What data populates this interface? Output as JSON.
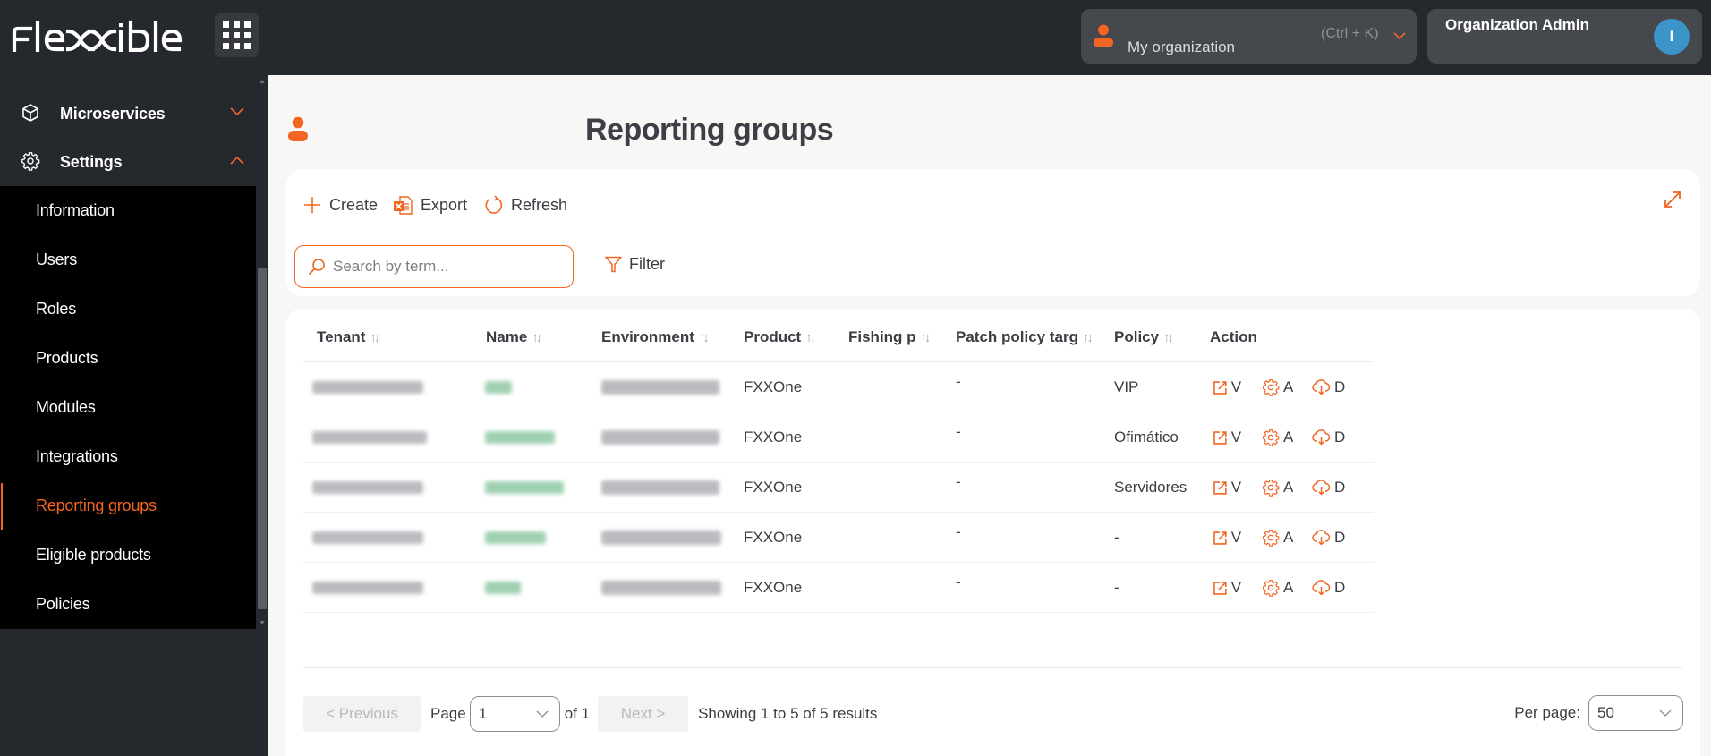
{
  "app": {
    "brand": "Flexxible"
  },
  "topbar": {
    "org_selector": {
      "label": "My organization",
      "shortcut": "(Ctrl + K)"
    },
    "user": {
      "role": "Organization Admin",
      "avatar_initial": "I"
    }
  },
  "sidebar": {
    "groups": [
      {
        "label": "Microservices",
        "icon": "cube-icon",
        "expanded": false
      },
      {
        "label": "Settings",
        "icon": "gear-icon",
        "expanded": true
      }
    ],
    "settings_items": [
      {
        "label": "Information",
        "active": false
      },
      {
        "label": "Users",
        "active": false
      },
      {
        "label": "Roles",
        "active": false
      },
      {
        "label": "Products",
        "active": false
      },
      {
        "label": "Modules",
        "active": false
      },
      {
        "label": "Integrations",
        "active": false
      },
      {
        "label": "Reporting groups",
        "active": true
      },
      {
        "label": "Eligible products",
        "active": false
      },
      {
        "label": "Policies",
        "active": false
      }
    ]
  },
  "page": {
    "title": "Reporting groups"
  },
  "toolbar": {
    "create_label": "Create",
    "export_label": "Export",
    "refresh_label": "Refresh",
    "search_placeholder": "Search by term...",
    "search_value": "",
    "filter_label": "Filter"
  },
  "table": {
    "columns": [
      {
        "label": "Tenant",
        "sortable": true
      },
      {
        "label": "Name",
        "sortable": true
      },
      {
        "label": "Environment",
        "sortable": true
      },
      {
        "label": "Product",
        "sortable": true
      },
      {
        "label": "Fishing p",
        "sortable": true
      },
      {
        "label": "Patch policy targ",
        "sortable": true
      },
      {
        "label": "Policy",
        "sortable": true
      },
      {
        "label": "Action",
        "sortable": false
      }
    ],
    "sort_glyph": "↑↓",
    "rows": [
      {
        "tenant": "[redacted]",
        "name": "[redacted]",
        "environment": "[redacted]",
        "product": "FXXOne",
        "fishing": "",
        "patch_policy_target": "-",
        "policy": "VIP"
      },
      {
        "tenant": "[redacted]",
        "name": "[redacted]",
        "environment": "[redacted]",
        "product": "FXXOne",
        "fishing": "",
        "patch_policy_target": "-",
        "policy": "Ofimático"
      },
      {
        "tenant": "[redacted]",
        "name": "[redacted]",
        "environment": "[redacted]",
        "product": "FXXOne",
        "fishing": "",
        "patch_policy_target": "-",
        "policy": "Servidores"
      },
      {
        "tenant": "[redacted]",
        "name": "[redacted]",
        "environment": "[redacted]",
        "product": "FXXOne",
        "fishing": "",
        "patch_policy_target": "-",
        "policy": "-"
      },
      {
        "tenant": "[redacted]",
        "name": "[redacted]",
        "environment": "[redacted]",
        "product": "FXXOne",
        "fishing": "",
        "patch_policy_target": "-",
        "policy": "-"
      }
    ],
    "actions": [
      {
        "label": "V",
        "icon": "external-link-icon"
      },
      {
        "label": "A",
        "icon": "gear-icon"
      },
      {
        "label": "D",
        "icon": "cloud-download-icon"
      }
    ]
  },
  "pagination": {
    "previous_label": "< Previous",
    "page_label": "Page",
    "current_page": "1",
    "of_label": "of 1",
    "next_label": "Next >",
    "summary": "Showing 1 to 5 of 5 results",
    "per_page_label": "Per page:",
    "per_page_value": "50"
  },
  "colors": {
    "accent": "#f26522",
    "topbar_bg": "#25282c",
    "submenu_bg": "#000000",
    "avatar_bg": "#3b95c9",
    "page_bg": "#f8f7f5"
  }
}
